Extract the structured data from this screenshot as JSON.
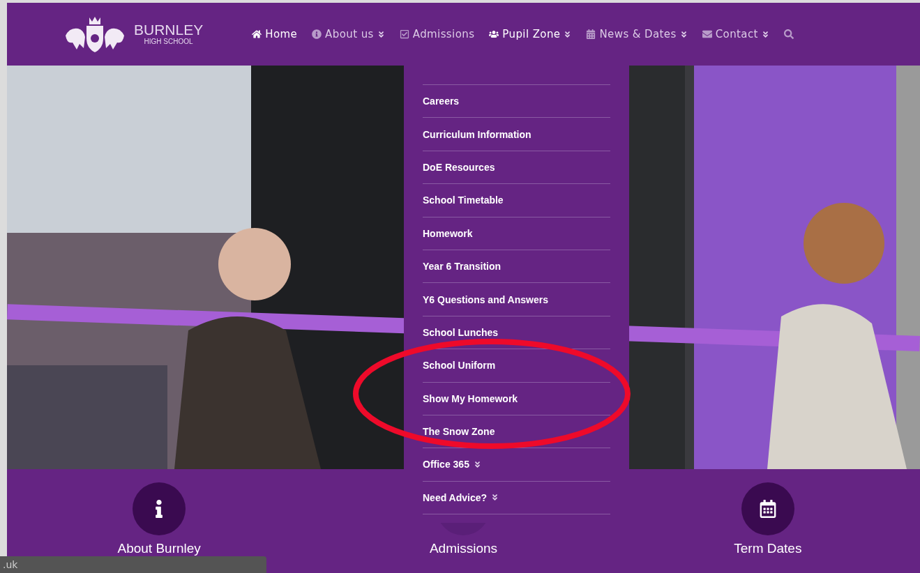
{
  "logo": {
    "name": "BURNLEY",
    "subtitle": "HIGH SCHOOL"
  },
  "nav": [
    {
      "label": "Home",
      "has_submenu": false,
      "selected": true
    },
    {
      "label": "About us",
      "has_submenu": true,
      "selected": false
    },
    {
      "label": "Admissions",
      "has_submenu": false,
      "selected": false
    },
    {
      "label": "Pupil Zone",
      "has_submenu": true,
      "selected": true
    },
    {
      "label": "News & Dates",
      "has_submenu": true,
      "selected": false
    },
    {
      "label": "Contact",
      "has_submenu": true,
      "selected": false
    }
  ],
  "dropdown": [
    {
      "label": "Careers",
      "has_submenu": false
    },
    {
      "label": "Curriculum Information",
      "has_submenu": false
    },
    {
      "label": "DoE Resources",
      "has_submenu": false
    },
    {
      "label": "School Timetable",
      "has_submenu": false
    },
    {
      "label": "Homework",
      "has_submenu": false
    },
    {
      "label": "Year 6 Transition",
      "has_submenu": false
    },
    {
      "label": "Y6 Questions and Answers",
      "has_submenu": false
    },
    {
      "label": "School Lunches",
      "has_submenu": false
    },
    {
      "label": "School Uniform",
      "has_submenu": false
    },
    {
      "label": "Show My Homework",
      "has_submenu": false
    },
    {
      "label": "The Snow Zone",
      "has_submenu": false
    },
    {
      "label": "Office 365",
      "has_submenu": true
    },
    {
      "label": "Need Advice?",
      "has_submenu": true
    }
  ],
  "features": [
    {
      "title": "About Burnley",
      "kind": "info"
    },
    {
      "title": "Admissions",
      "kind": "hidden"
    },
    {
      "title": "Term Dates",
      "kind": "calendar"
    }
  ],
  "status_bar": {
    "text": ".uk"
  }
}
